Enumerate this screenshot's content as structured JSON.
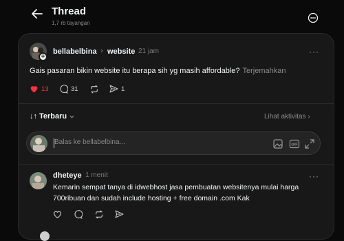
{
  "header": {
    "title": "Thread",
    "subtitle": "1,7 rb tayangan"
  },
  "post": {
    "username": "bellabelbina",
    "topic": "website",
    "time": "21 jam",
    "text": "Gais pasaran bikin website itu berapa sih yg masih affordable?",
    "translate": "Terjemahkan",
    "likes": "13",
    "comments": "31",
    "shares": "1"
  },
  "sort": {
    "label": "Terbaru",
    "activity": "Lihat aktivitas"
  },
  "reply": {
    "placeholder": "Balas ke bellabelbina..."
  },
  "comment": {
    "username": "dheteye",
    "time": "1 menit",
    "text": "Kemarin sempat tanya di idwebhost jasa pembuatan websitenya mulai harga 700ribuan dan sudah include hosting + free domain .com Kak"
  },
  "colors": {
    "bg": "#0a0a0a",
    "panel": "#181818",
    "like": "#ff3040"
  }
}
